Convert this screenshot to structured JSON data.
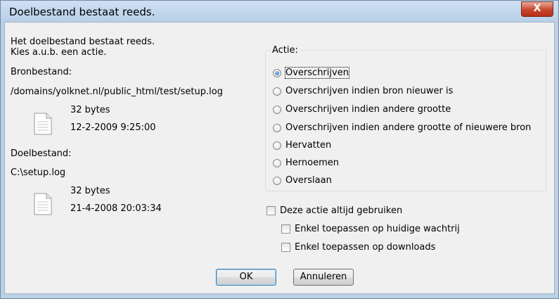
{
  "dialog": {
    "title": "Doelbestand bestaat reeds.",
    "close_label": "X"
  },
  "message": {
    "line1": "Het doelbestand bestaat reeds.",
    "line2": "Kies a.u.b. een actie."
  },
  "source": {
    "heading": "Bronbestand:",
    "path": "/domains/yolknet.nl/public_html/test/setup.log",
    "size": "32 bytes",
    "date": "12-2-2009 9:25:00",
    "icon": "document-icon"
  },
  "target": {
    "heading": "Doelbestand:",
    "path": "C:\\setup.log",
    "size": "32 bytes",
    "date": "21-4-2008 20:03:34",
    "icon": "document-icon"
  },
  "action_group": {
    "legend": "Actie:",
    "options": [
      {
        "label": "Overschrijven",
        "selected": true
      },
      {
        "label": "Overschrijven indien bron nieuwer is",
        "selected": false
      },
      {
        "label": "Overschrijven indien andere grootte",
        "selected": false
      },
      {
        "label": "Overschrijven indien andere grootte of nieuwere bron",
        "selected": false
      },
      {
        "label": "Hervatten",
        "selected": false
      },
      {
        "label": "Hernoemen",
        "selected": false
      },
      {
        "label": "Overslaan",
        "selected": false
      }
    ]
  },
  "checkboxes": {
    "always": {
      "label": "Deze actie altijd gebruiken",
      "checked": false
    },
    "queue": {
      "label": "Enkel toepassen op huidige wachtrij",
      "checked": false
    },
    "downloads": {
      "label": "Enkel toepassen op downloads",
      "checked": false
    }
  },
  "buttons": {
    "ok": "OK",
    "cancel": "Annuleren"
  },
  "colors": {
    "titlebar": "#b9cfe8",
    "close_button": "#c8452c",
    "dialog_background": "#f0f0f0",
    "default_button_border": "#3c7fb1"
  }
}
